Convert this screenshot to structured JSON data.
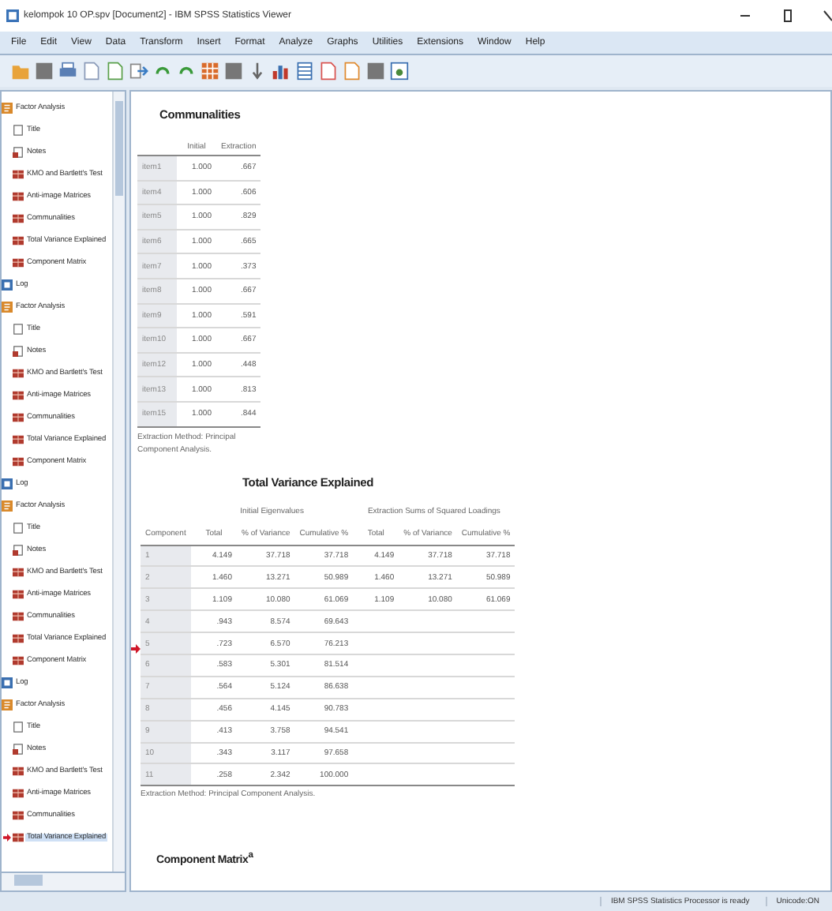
{
  "window": {
    "title": "kelompok 10 OP.spv [Document2] - IBM SPSS Statistics Viewer"
  },
  "menu": [
    "File",
    "Edit",
    "View",
    "Data",
    "Transform",
    "Insert",
    "Format",
    "Analyze",
    "Graphs",
    "Utilities",
    "Extensions",
    "Window",
    "Help"
  ],
  "outline": [
    {
      "kind": "factor",
      "label": "Factor Analysis",
      "children": [
        {
          "kind": "title",
          "label": "Title",
          "selected": false
        },
        {
          "kind": "notes",
          "label": "Notes",
          "selected": false
        },
        {
          "kind": "table",
          "label": "KMO and Bartlett's Test",
          "selected": false
        },
        {
          "kind": "table",
          "label": "Anti-image Matrices",
          "selected": false
        },
        {
          "kind": "table",
          "label": "Communalities",
          "selected": false
        },
        {
          "kind": "table",
          "label": "Total Variance Explained",
          "selected": false
        },
        {
          "kind": "table",
          "label": "Component Matrix",
          "selected": false
        }
      ]
    },
    {
      "kind": "log",
      "label": "Log"
    },
    {
      "kind": "factor",
      "label": "Factor Analysis",
      "children": [
        {
          "kind": "title",
          "label": "Title",
          "selected": false
        },
        {
          "kind": "notes",
          "label": "Notes",
          "selected": false
        },
        {
          "kind": "table",
          "label": "KMO and Bartlett's Test",
          "selected": false
        },
        {
          "kind": "table",
          "label": "Anti-image Matrices",
          "selected": false
        },
        {
          "kind": "table",
          "label": "Communalities",
          "selected": false
        },
        {
          "kind": "table",
          "label": "Total Variance Explained",
          "selected": false
        },
        {
          "kind": "table",
          "label": "Component Matrix",
          "selected": false
        }
      ]
    },
    {
      "kind": "log",
      "label": "Log"
    },
    {
      "kind": "factor",
      "label": "Factor Analysis",
      "children": [
        {
          "kind": "title",
          "label": "Title",
          "selected": false
        },
        {
          "kind": "notes",
          "label": "Notes",
          "selected": false
        },
        {
          "kind": "table",
          "label": "KMO and Bartlett's Test",
          "selected": false
        },
        {
          "kind": "table",
          "label": "Anti-image Matrices",
          "selected": false
        },
        {
          "kind": "table",
          "label": "Communalities",
          "selected": false
        },
        {
          "kind": "table",
          "label": "Total Variance Explained",
          "selected": false
        },
        {
          "kind": "table",
          "label": "Component Matrix",
          "selected": false
        }
      ]
    },
    {
      "kind": "log",
      "label": "Log"
    },
    {
      "kind": "factor",
      "label": "Factor Analysis",
      "children": [
        {
          "kind": "title",
          "label": "Title",
          "selected": false
        },
        {
          "kind": "notes",
          "label": "Notes",
          "selected": false
        },
        {
          "kind": "table",
          "label": "KMO and Bartlett's Test",
          "selected": false
        },
        {
          "kind": "table",
          "label": "Anti-image Matrices",
          "selected": false
        },
        {
          "kind": "table",
          "label": "Communalities",
          "selected": false
        },
        {
          "kind": "table",
          "label": "Total Variance Explained",
          "selected": true
        }
      ]
    }
  ],
  "communalities": {
    "title": "Communalities",
    "columns": [
      "Initial",
      "Extraction"
    ],
    "rows": [
      {
        "label": "item1",
        "initial": "1.000",
        "extraction": ".667"
      },
      {
        "label": "item4",
        "initial": "1.000",
        "extraction": ".606"
      },
      {
        "label": "item5",
        "initial": "1.000",
        "extraction": ".829"
      },
      {
        "label": "item6",
        "initial": "1.000",
        "extraction": ".665"
      },
      {
        "label": "item7",
        "initial": "1.000",
        "extraction": ".373"
      },
      {
        "label": "item8",
        "initial": "1.000",
        "extraction": ".667"
      },
      {
        "label": "item9",
        "initial": "1.000",
        "extraction": ".591"
      },
      {
        "label": "item10",
        "initial": "1.000",
        "extraction": ".667"
      },
      {
        "label": "item12",
        "initial": "1.000",
        "extraction": ".448"
      },
      {
        "label": "item13",
        "initial": "1.000",
        "extraction": ".813"
      },
      {
        "label": "item15",
        "initial": "1.000",
        "extraction": ".844"
      }
    ],
    "footnote": "Extraction Method: Principal Component Analysis."
  },
  "total_variance": {
    "title": "Total Variance Explained",
    "marker": true,
    "groups": [
      "Initial Eigenvalues",
      "Extraction Sums of Squared Loadings"
    ],
    "columns": [
      "Component",
      "Total",
      "% of Variance",
      "Cumulative %",
      "Total",
      "% of Variance",
      "Cumulative %"
    ],
    "rows": [
      [
        "1",
        "4.149",
        "37.718",
        "37.718",
        "4.149",
        "37.718",
        "37.718"
      ],
      [
        "2",
        "1.460",
        "13.271",
        "50.989",
        "1.460",
        "13.271",
        "50.989"
      ],
      [
        "3",
        "1.109",
        "10.080",
        "61.069",
        "1.109",
        "10.080",
        "61.069"
      ],
      [
        "4",
        ".943",
        "8.574",
        "69.643"
      ],
      [
        "5",
        ".723",
        "6.570",
        "76.213"
      ],
      [
        "6",
        ".583",
        "5.301",
        "81.514"
      ],
      [
        "7",
        ".564",
        "5.124",
        "86.638"
      ],
      [
        "8",
        ".456",
        "4.145",
        "90.783"
      ],
      [
        "9",
        ".413",
        "3.758",
        "94.541"
      ],
      [
        "10",
        ".343",
        "3.117",
        "97.658"
      ],
      [
        "11",
        ".258",
        "2.342",
        "100.000"
      ]
    ],
    "footnote": "Extraction Method: Principal Component Analysis."
  },
  "component_matrix": {
    "title": "Component Matrix$^{a}$"
  },
  "status_bar": [
    "IBM SPSS Statistics Processor is ready",
    "Unicode:ON"
  ]
}
